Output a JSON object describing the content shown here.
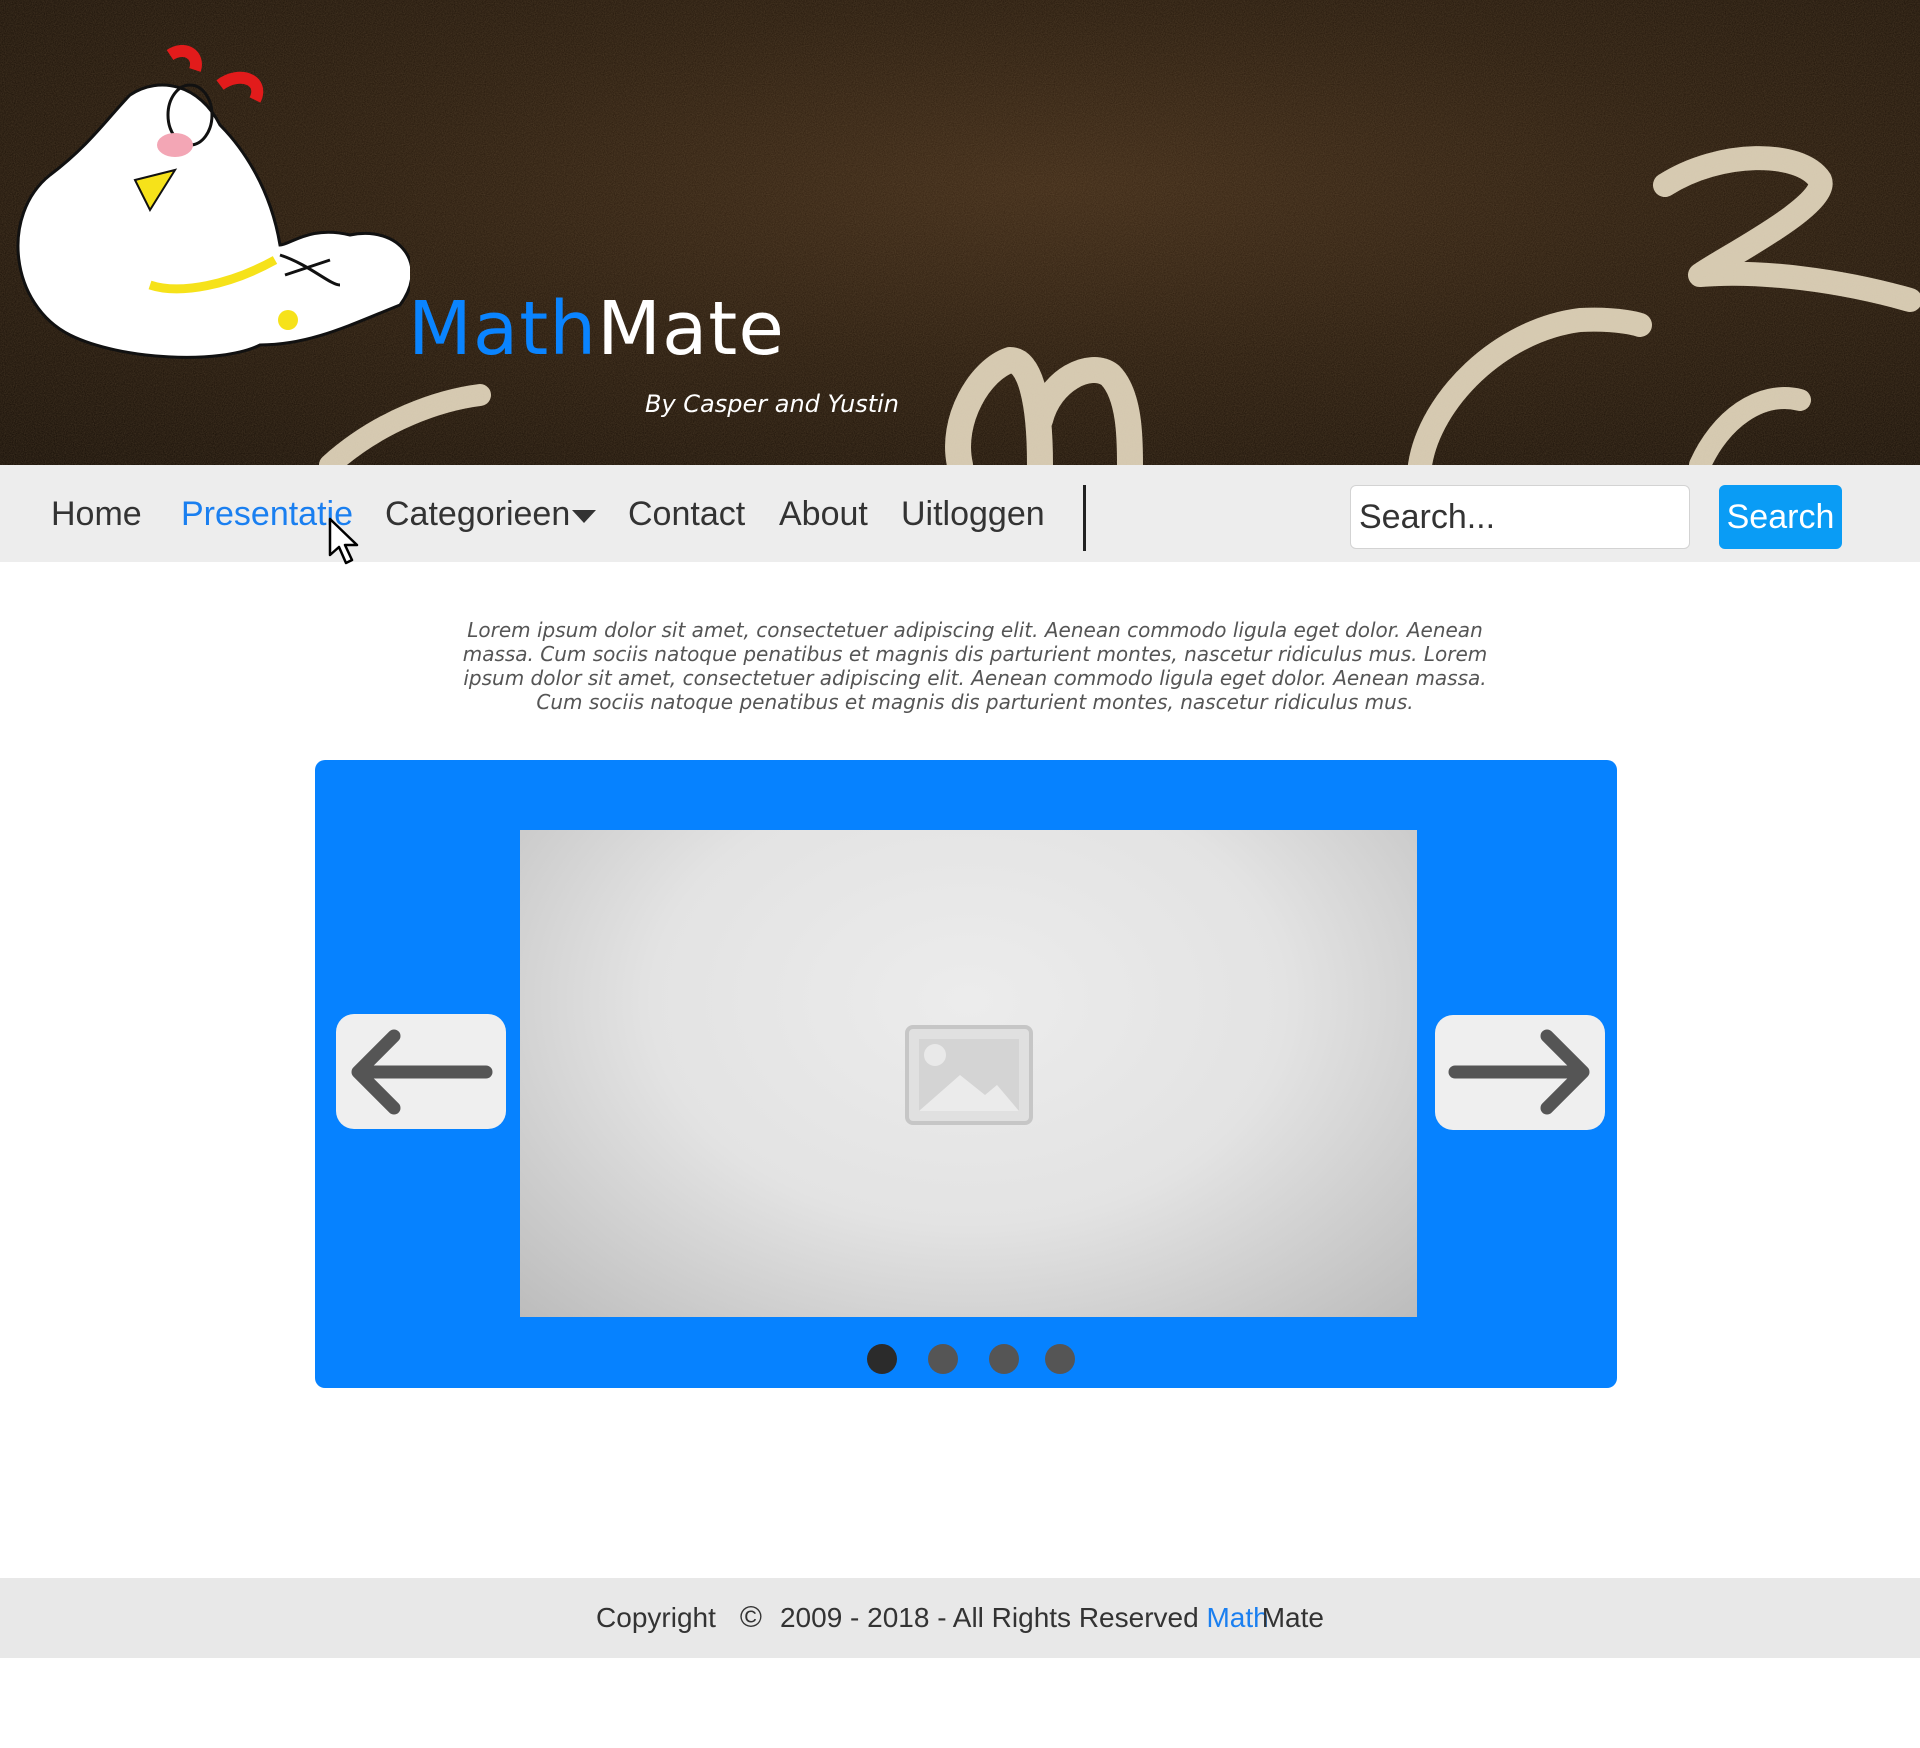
{
  "header": {
    "brand_part1": "Math",
    "brand_part2": "Mate",
    "byline": "By Casper and Yustin"
  },
  "nav": {
    "items": [
      {
        "label": "Home",
        "active": false
      },
      {
        "label": "Presentatie",
        "active": true
      },
      {
        "label": "Categorieen",
        "active": false,
        "has_dropdown": true
      },
      {
        "label": "Contact",
        "active": false
      },
      {
        "label": "About",
        "active": false
      },
      {
        "label": "Uitloggen",
        "active": false
      }
    ],
    "search_placeholder": "Search...",
    "search_button": "Search"
  },
  "content": {
    "intro_text": "Lorem ipsum dolor sit amet, consectetuer adipiscing elit. Aenean commodo ligula eget dolor. Aenean massa. Cum sociis natoque penatibus et magnis dis parturient montes, nascetur ridiculus mus. Lorem ipsum dolor sit amet, consectetuer adipiscing elit. Aenean commodo ligula eget dolor. Aenean massa. Cum sociis natoque penatibus et magnis dis parturient montes, nascetur ridiculus mus."
  },
  "slider": {
    "slide_count": 4,
    "active_slide": 1,
    "icons": {
      "prev": "arrow-left-icon",
      "next": "arrow-right-icon",
      "placeholder": "image-placeholder-icon"
    }
  },
  "footer": {
    "copyright_label": "Copyright",
    "copyright_symbol": "©",
    "years_text": "2009 - 2018 - All Rights Reserved",
    "brand_part1": "Math",
    "brand_part2": "Mate"
  },
  "colors": {
    "accent": "#0a84ff",
    "slider_bg": "#0682ff",
    "search_button": "#0a9cf5",
    "nav_bg": "#ededed",
    "footer_bg": "#e8e8e8"
  }
}
